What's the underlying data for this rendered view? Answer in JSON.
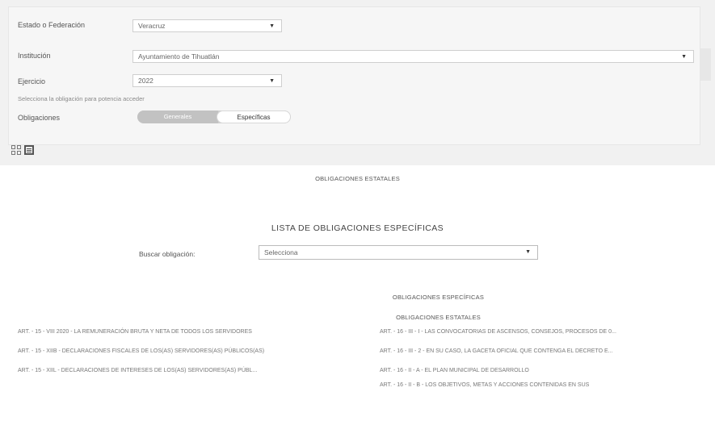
{
  "filters": {
    "estado_label": "Estado o Federación",
    "estado_value": "Veracruz",
    "institucion_label": "Institución",
    "institucion_value": "Ayuntamiento de Tihuatlán",
    "ejercicio_label": "Ejercicio",
    "ejercicio_value": "2022",
    "hint": "Selecciona la obligación para potencia acceder",
    "obligaciones_label": "Obligaciones",
    "toggle_generales": "Generales",
    "toggle_especificas": "Específicas"
  },
  "main": {
    "section_heading": "OBLIGACIONES ESTATALES",
    "list_title": "LISTA DE OBLIGACIONES ESPECÍFICAS",
    "search_label": "Buscar obligación:",
    "search_value": "Selecciona",
    "sub_heading_1": "OBLIGACIONES ESPECÍFICAS",
    "sub_heading_2": "OBLIGACIONES ESTATALES"
  },
  "obligations_left": [
    "ART. - 15 - VIII 2020 - LA REMUNERACIÓN BRUTA Y NETA DE TODOS LOS SERVIDORES",
    "ART. - 15 - XIIB - DECLARACIONES FISCALES DE LOS(AS) SERVIDORES(AS) PÚBLICOS(AS)",
    "ART. - 15 - XIIL - DECLARACIONES DE INTERESES DE LOS(AS) SERVIDORES(AS) PÚBL..."
  ],
  "obligations_right": [
    "ART. - 16 - III - I - LAS CONVOCATORIAS DE ASCENSOS, CONSEJOS, PROCESOS DE 0...",
    "ART. - 16 - III - 2 - EN SU CASO, LA GACETA OFICIAL QUE CONTENGA EL DECRETO E...",
    "ART. - 16 - II - A - EL PLAN MUNICIPAL DE DESARROLLO",
    "ART. - 16 - II - B - LOS OBJETIVOS, METAS Y ACCIONES CONTENIDAS EN SUS"
  ],
  "icons": [
    "grid-view-icon",
    "list-view-icon",
    "chevron-down-icon"
  ]
}
